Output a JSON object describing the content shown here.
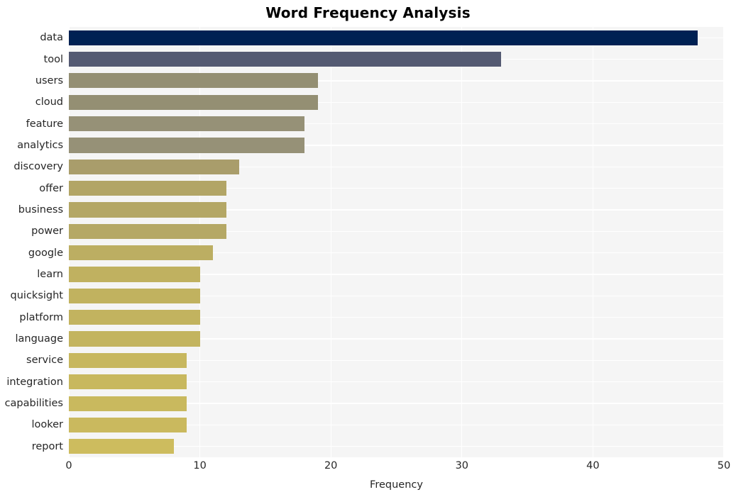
{
  "chart_data": {
    "type": "bar",
    "orientation": "horizontal",
    "title": "Word Frequency Analysis",
    "xlabel": "Frequency",
    "ylabel": "",
    "xlim": [
      0,
      50
    ],
    "xticks": [
      0,
      10,
      20,
      30,
      40,
      50
    ],
    "xtick_labels": [
      "0",
      "10",
      "20",
      "30",
      "40",
      "50"
    ],
    "grid": true,
    "legend": "none",
    "background": "#f5f5f5",
    "gridline_color": "#ffffff",
    "categories": [
      "data",
      "tool",
      "users",
      "cloud",
      "feature",
      "analytics",
      "discovery",
      "offer",
      "business",
      "power",
      "google",
      "learn",
      "quicksight",
      "platform",
      "language",
      "service",
      "integration",
      "capabilities",
      "looker",
      "report"
    ],
    "values": [
      48,
      33,
      19,
      19,
      18,
      18,
      13,
      12,
      12,
      12,
      11,
      10,
      10,
      10,
      10,
      9,
      9,
      9,
      9,
      8
    ],
    "bar_colors": [
      "#002153",
      "#545a72",
      "#948f73",
      "#948f73",
      "#969177",
      "#969177",
      "#a99d6b",
      "#b2a566",
      "#b4a765",
      "#b5a865",
      "#bcae62",
      "#c0b160",
      "#c1b25f",
      "#c2b35f",
      "#c3b45f",
      "#c7b75e",
      "#c8b85e",
      "#c9b95e",
      "#cab95e",
      "#cdbc5e"
    ]
  }
}
